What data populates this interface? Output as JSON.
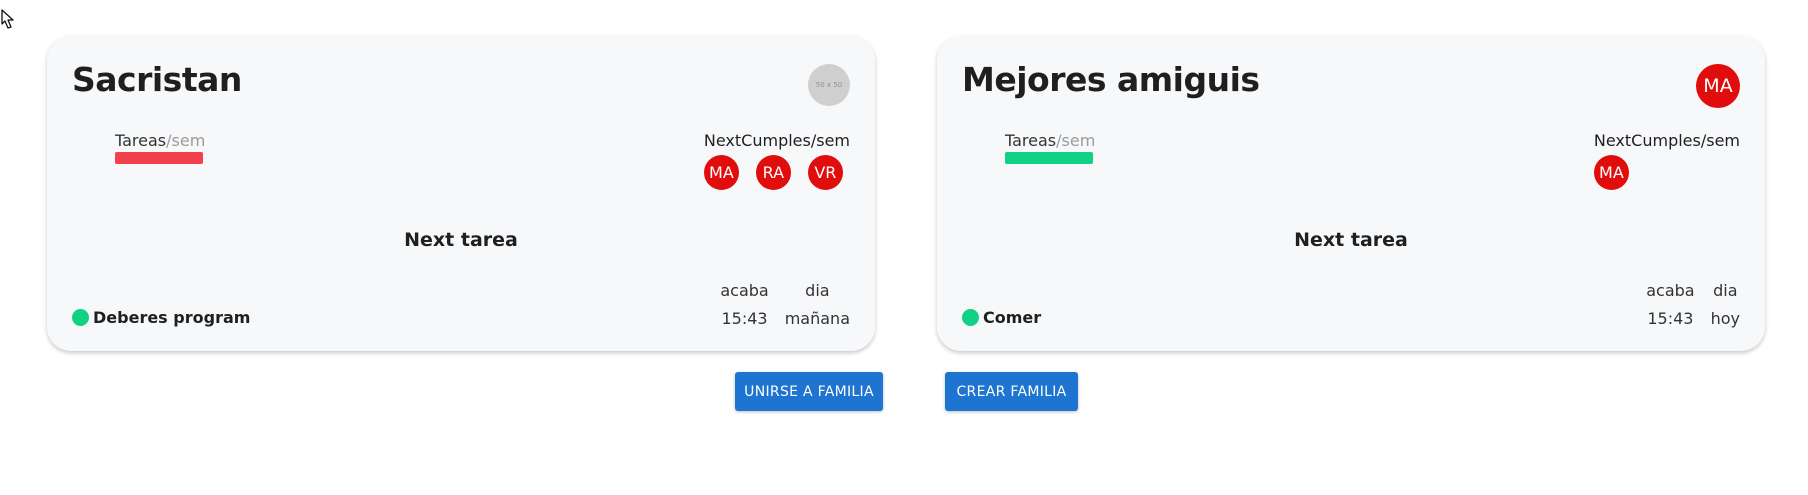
{
  "colors": {
    "card_bg": "#f7f8fa",
    "avatar_red": "#e10d0d",
    "bar_red": "#f0414d",
    "bar_green": "#10d184",
    "dot_green": "#10d184",
    "button_blue": "#1e74d1"
  },
  "families": [
    {
      "name": "Sacristan",
      "avatar_text": "50 x 50",
      "tareas_label": "Tareas",
      "tareas_unit": "/sem",
      "tareas_bar_color": "#f0414d",
      "cumples_label": "NextCumples/sem",
      "cumples_avatars": [
        "MA",
        "RA",
        "VR"
      ],
      "next_title": "Next tarea",
      "task_name": "Deberes program",
      "task_icon": "green-dot-icon",
      "acaba_label": "acaba",
      "dia_label": "dia",
      "acaba_value": "15:43",
      "dia_value": "mañana"
    },
    {
      "name": "Mejores amiguis",
      "avatar_text": "MA",
      "tareas_label": "Tareas",
      "tareas_unit": "/sem",
      "tareas_bar_color": "#10d184",
      "cumples_label": "NextCumples/sem",
      "cumples_avatars": [
        "MA"
      ],
      "next_title": "Next tarea",
      "task_name": "Comer",
      "task_icon": "green-dot-icon",
      "acaba_label": "acaba",
      "dia_label": "dia",
      "acaba_value": "15:43",
      "dia_value": "hoy"
    }
  ],
  "buttons": {
    "join_label": "UNIRSE A FAMILIA",
    "create_label": "CREAR FAMILIA"
  },
  "cursor": "hand-pointer-icon"
}
